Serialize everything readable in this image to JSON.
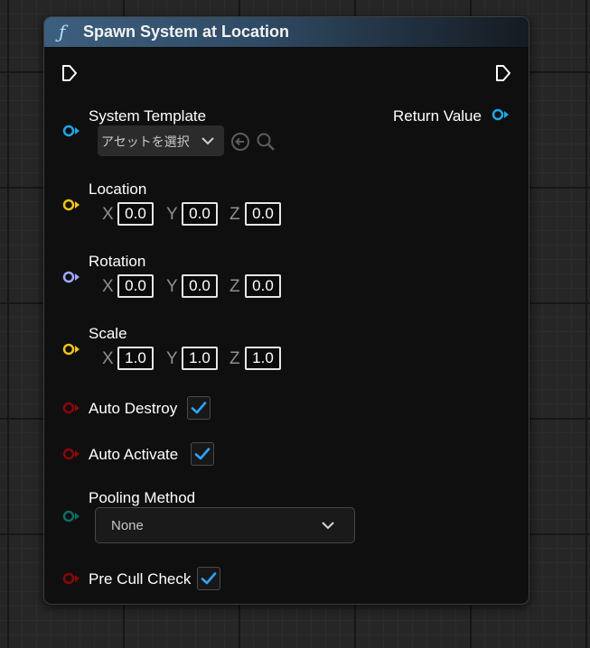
{
  "node": {
    "title": "Spawn System at Location",
    "function_icon": "ƒ"
  },
  "return_value": {
    "label": "Return Value"
  },
  "system_template": {
    "label": "System Template",
    "asset_combo_text": "アセットを選択"
  },
  "location": {
    "label": "Location",
    "x_axis": "X",
    "y_axis": "Y",
    "z_axis": "Z",
    "x": "0.0",
    "y": "0.0",
    "z": "0.0"
  },
  "rotation": {
    "label": "Rotation",
    "x_axis": "X",
    "y_axis": "Y",
    "z_axis": "Z",
    "x": "0.0",
    "y": "0.0",
    "z": "0.0"
  },
  "scale": {
    "label": "Scale",
    "x_axis": "X",
    "y_axis": "Y",
    "z_axis": "Z",
    "x": "1.0",
    "y": "1.0",
    "z": "1.0"
  },
  "auto_destroy": {
    "label": "Auto Destroy",
    "checked": true
  },
  "auto_activate": {
    "label": "Auto Activate",
    "checked": true
  },
  "pooling_method": {
    "label": "Pooling Method",
    "value": "None"
  },
  "pre_cull_check": {
    "label": "Pre Cull Check",
    "checked": true
  },
  "colors": {
    "object_pin": "#1ea7e8",
    "vector_pin": "#f0c21a",
    "rotator_pin": "#a0a8ff",
    "bool_pin": "#8c0606",
    "enum_pin": "#0e6b66",
    "exec_pin": "#ffffff",
    "checkbox_accent": "#2ea4ff"
  },
  "icons": {
    "exec_in": "exec-pin-icon",
    "exec_out": "exec-pin-icon",
    "object": "object-pin-icon",
    "vector": "vector-pin-icon",
    "rotator": "rotator-pin-icon",
    "bool": "bool-pin-icon",
    "enum": "enum-pin-icon",
    "use_selected": "use-selected-asset-icon",
    "browse": "browse-search-icon",
    "dropdown": "chevron-down-icon",
    "check": "checkmark-icon"
  }
}
